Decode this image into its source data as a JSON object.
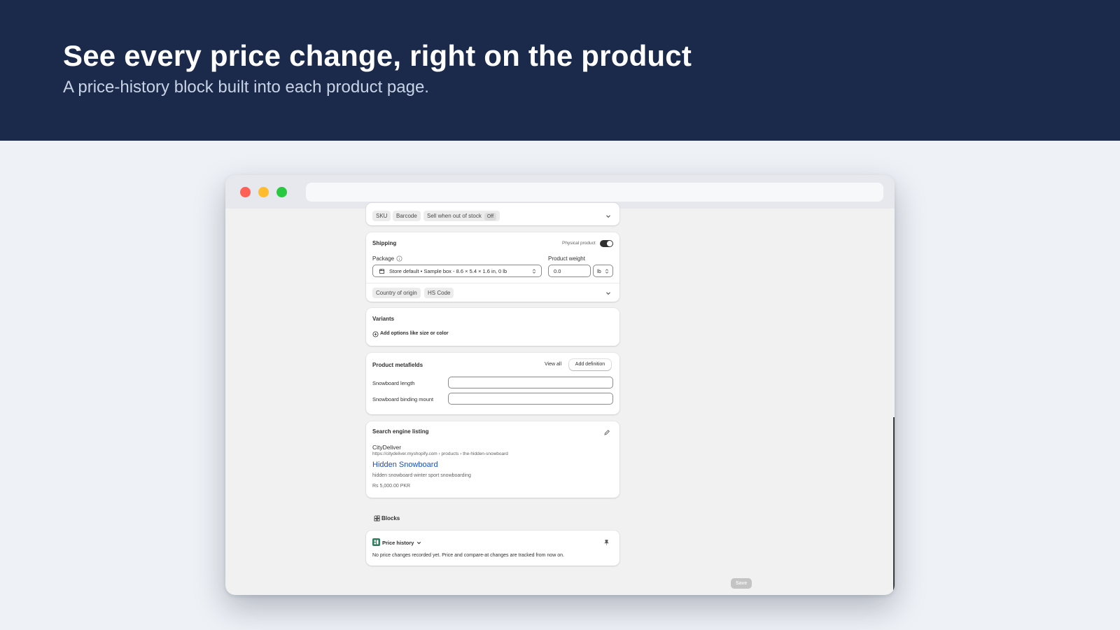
{
  "hero": {
    "title": "See every price change, right on the product",
    "subtitle": "A price-history block built into each product page."
  },
  "inventory": {
    "chips": [
      "SKU",
      "Barcode"
    ],
    "sell_when_out": "Sell when out of stock",
    "sell_when_out_state": "Off"
  },
  "shipping": {
    "title": "Shipping",
    "physical_product_label": "Physical product",
    "package_label": "Package",
    "package_value": "Store default • Sample box - 8.6 × 5.4 × 1.6 in, 0 lb",
    "weight_label": "Product weight",
    "weight_value": "0.0",
    "weight_unit": "lb",
    "extra_chips": [
      "Country of origin",
      "HS Code"
    ]
  },
  "variants": {
    "title": "Variants",
    "add_options": "Add options like size or color"
  },
  "metafields": {
    "title": "Product metafields",
    "view_all": "View all",
    "add_definition": "Add definition",
    "fields": [
      "Snowboard length",
      "Snowboard binding mount"
    ]
  },
  "seo": {
    "title": "Search engine listing",
    "store_name": "CityDeliver",
    "url": "https://citydeliver.myshopify.com › products › the-hidden-snowboard",
    "page_title": "Hidden Snowboard",
    "description": "hidden snowboard winter sport snowboarding",
    "price": "Rs 5,000.00 PKR"
  },
  "blocks": {
    "heading": "Blocks",
    "price_history_title": "Price history",
    "price_history_message": "No price changes recorded yet. Price and compare-at changes are tracked from now on."
  },
  "footer": {
    "save_label": "Save"
  },
  "colors": {
    "hero_bg": "#1b2a4a",
    "link_blue": "#1a4fbf",
    "block_icon_green": "#2e7d5b"
  }
}
